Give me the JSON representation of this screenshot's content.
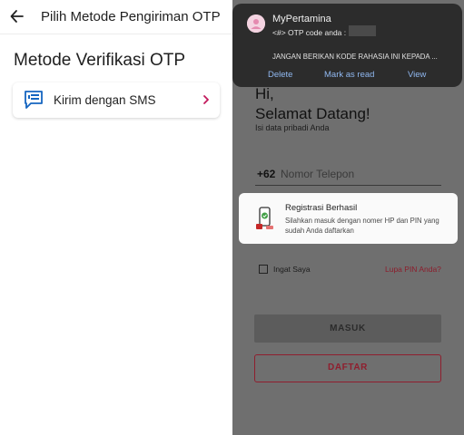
{
  "left": {
    "header": {
      "title": "Pilih Metode Pengiriman OTP",
      "back_icon": "arrow-left-icon"
    },
    "section_title": "Metode Verifikasi OTP",
    "option": {
      "label": "Kirim dengan SMS",
      "icon": "sms-chat-icon",
      "chevron_icon": "chevron-right-icon",
      "accent": "#1565c0",
      "chevron_color": "#c2185b"
    }
  },
  "right": {
    "notification": {
      "app_name": "MyPertamina",
      "code_text": "<#> OTP code anda :",
      "body": "JANGAN BERIKAN KODE RAHASIA INI KEPADA ...",
      "actions": [
        "Delete",
        "Mark as read",
        "View"
      ],
      "action_color": "#90b8f0"
    },
    "greeting": {
      "line1": "Hi,",
      "line2": "Selamat Datang!",
      "sub": "Isi data pribadi Anda"
    },
    "phone": {
      "prefix": "+62",
      "placeholder": "Nomor Telepon"
    },
    "toast": {
      "title": "Registrasi Berhasil",
      "text": "Silahkan masuk dengan nomer HP dan PIN yang sudah Anda daftarkan",
      "icon": "phone-success-icon"
    },
    "remember_label": "Ingat Saya",
    "forgot_label": "Lupa PIN Anda?",
    "login_button": "MASUK",
    "register_button": "DAFTAR",
    "brand_color": "#8f1e2e"
  }
}
